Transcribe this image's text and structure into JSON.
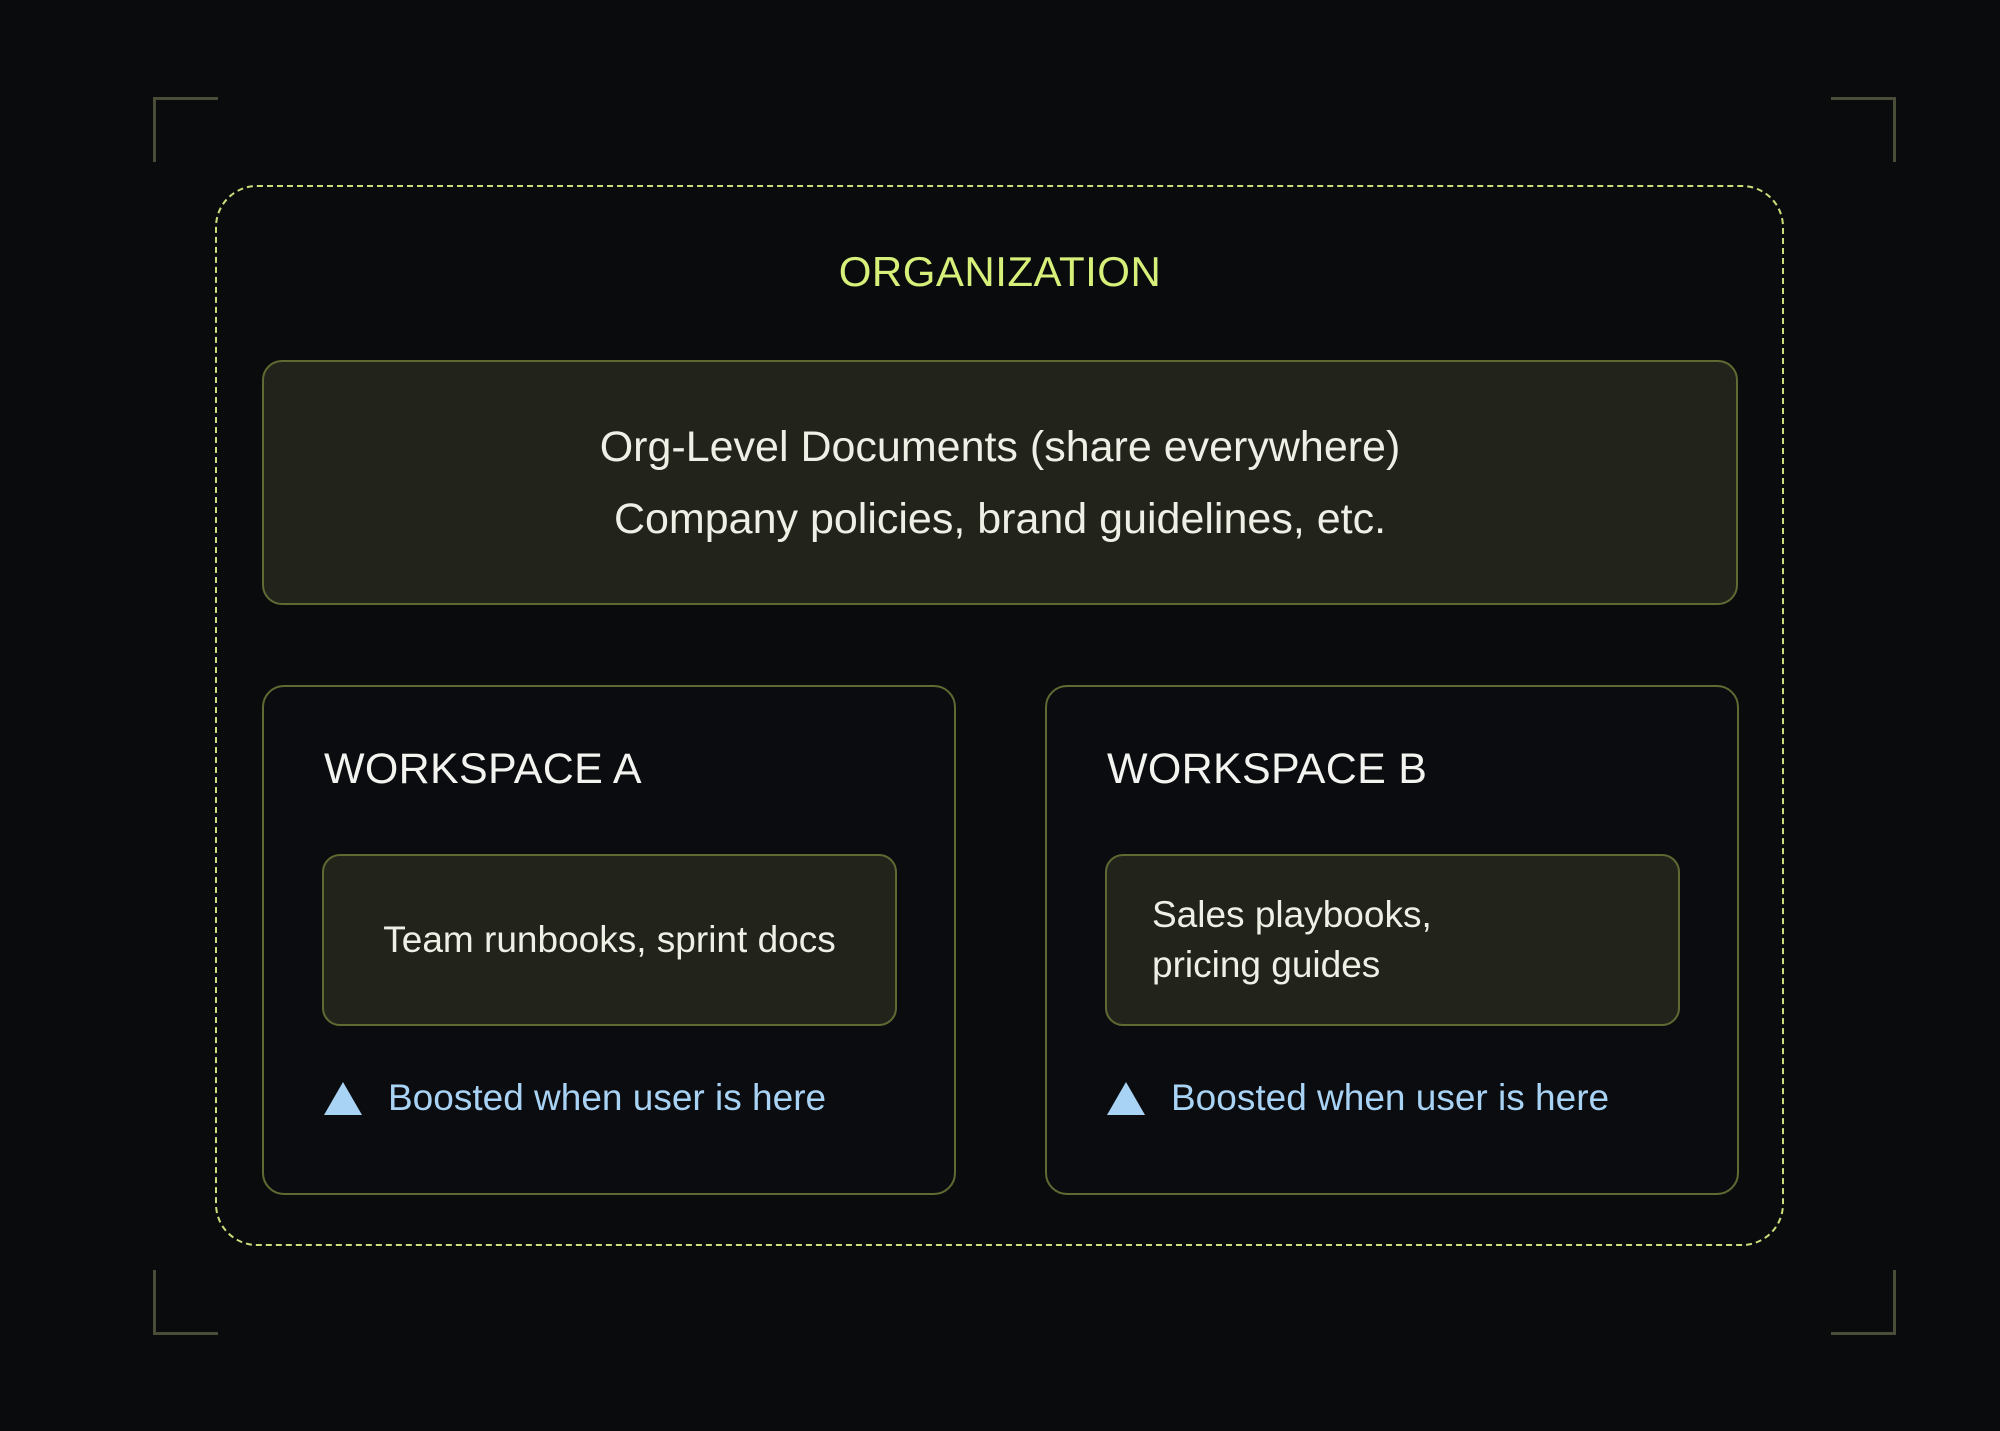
{
  "organization": {
    "title": "ORGANIZATION",
    "org_docs": {
      "line1": "Org-Level Documents (share everywhere)",
      "line2": "Company policies, brand guidelines, etc."
    }
  },
  "workspaces": [
    {
      "title": "WORKSPACE A",
      "docs_line1": "Team runbooks, sprint docs",
      "boost_label": "Boosted when user is here"
    },
    {
      "title": "WORKSPACE B",
      "docs_line1": "Sales playbooks,",
      "docs_line2": "pricing guides",
      "boost_label": "Boosted when user is here"
    }
  ],
  "colors": {
    "background": "#0a0b0d",
    "accent": "#d6f07a",
    "panel_border": "#5f6a33",
    "panel_fill": "#22241c",
    "boost": "#a8d3f5"
  },
  "icons": {
    "boost": "triangle-up-icon"
  }
}
